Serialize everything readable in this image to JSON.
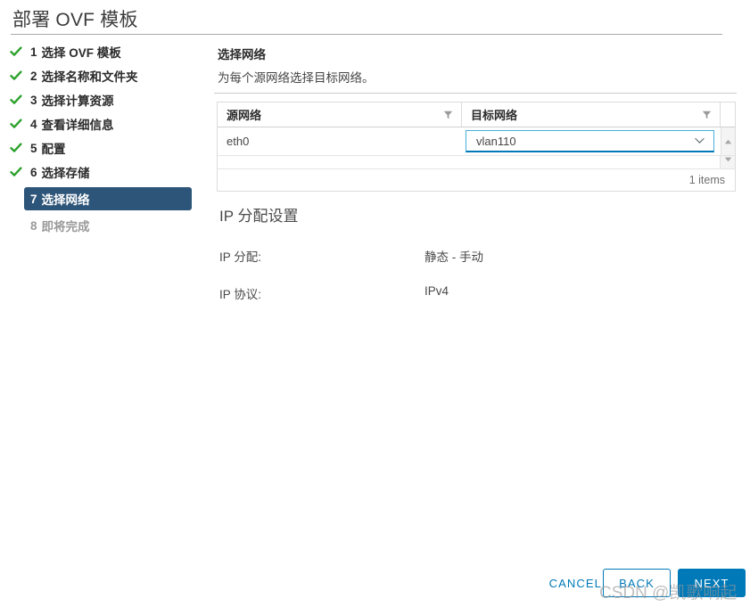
{
  "header": {
    "title": "部署 OVF 模板"
  },
  "sidebar": {
    "items": [
      {
        "num": "1",
        "label": "选择 OVF 模板",
        "state": "done"
      },
      {
        "num": "2",
        "label": "选择名称和文件夹",
        "state": "done"
      },
      {
        "num": "3",
        "label": "选择计算资源",
        "state": "done"
      },
      {
        "num": "4",
        "label": "查看详细信息",
        "state": "done"
      },
      {
        "num": "5",
        "label": "配置",
        "state": "done"
      },
      {
        "num": "6",
        "label": "选择存储",
        "state": "done"
      },
      {
        "num": "7",
        "label": "选择网络",
        "state": "active"
      },
      {
        "num": "8",
        "label": "即将完成",
        "state": "pending"
      }
    ]
  },
  "main": {
    "heading": "选择网络",
    "subtitle": "为每个源网络选择目标网络。",
    "table": {
      "columns": [
        "源网络",
        "目标网络"
      ],
      "rows": [
        {
          "source": "eth0",
          "target": "vlan110"
        }
      ],
      "footer": "1 items"
    }
  },
  "ip_settings": {
    "title": "IP 分配设置",
    "rows": [
      {
        "label": "IP 分配:",
        "value": "静态 - 手动"
      },
      {
        "label": "IP 协议:",
        "value": "IPv4"
      }
    ]
  },
  "footer": {
    "cancel": "CANCEL",
    "back": "BACK",
    "next": "NEXT"
  },
  "watermark": {
    "text": "CSDN @凯歌响起"
  },
  "colors": {
    "accent_blue": "#0079b8",
    "active_step_bg": "#2d5579",
    "check_green": "#2da12d",
    "focus_cyan": "#49afd9"
  }
}
